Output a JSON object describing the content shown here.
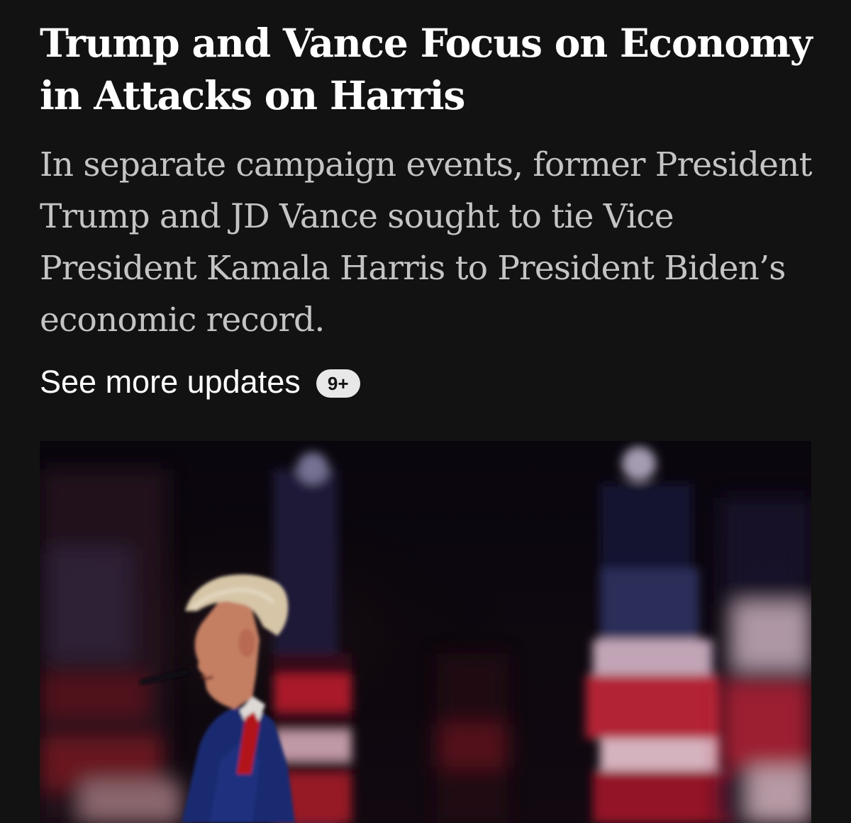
{
  "article": {
    "headline": "Trump and Vance Focus on Economy in Attacks on Harris",
    "summary": "In separate campaign events, former President Trump and JD Vance sought to tie Vice President Kamala Harris to President Biden’s economic record.",
    "see_more_label": "See more updates",
    "updates_badge": "9+"
  },
  "colors": {
    "background": "#121212",
    "headline_text": "#ffffff",
    "summary_text": "#c4c4c4",
    "badge_background": "#e8e8e8"
  }
}
